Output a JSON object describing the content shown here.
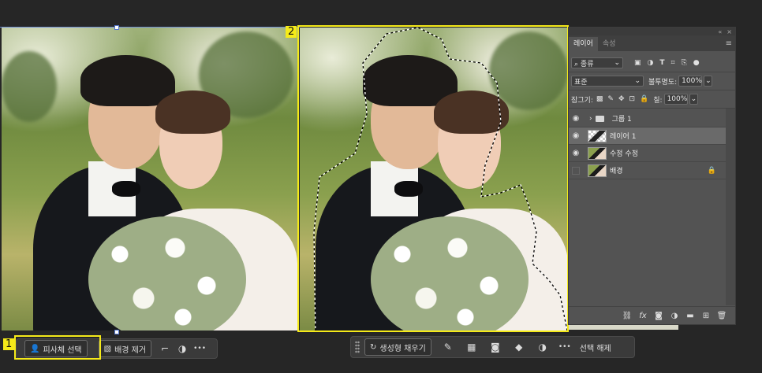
{
  "annotations": {
    "box1_label": "1",
    "box2_label": "2"
  },
  "left_taskbar": {
    "select_subject_label": "피사체 선택",
    "remove_background_label": "배경 제거",
    "more_label": "•••"
  },
  "right_taskbar": {
    "generative_fill_label": "생성형 채우기",
    "more_label": "•••",
    "deselect_label": "선택 해제"
  },
  "layers_panel": {
    "tabs": [
      {
        "label": "레이어"
      },
      {
        "label": "속성"
      }
    ],
    "filter_kind": "종류",
    "blend_mode": "표준",
    "opacity_label": "불투명도:",
    "opacity_value": "100%",
    "lock_label": "잠그기:",
    "fill_label": "칠:",
    "fill_value": "100%",
    "layers": [
      {
        "name": "그룹 1",
        "type": "group"
      },
      {
        "name": "레이어 1",
        "type": "layer-mask"
      },
      {
        "name": "수정 수정",
        "type": "layer"
      },
      {
        "name": "배경",
        "type": "background"
      }
    ],
    "footer_fx": "fx"
  },
  "colors": {
    "selection_yellow": "#f5ea19",
    "panel_bg": "#535353",
    "app_bg": "#262626"
  }
}
